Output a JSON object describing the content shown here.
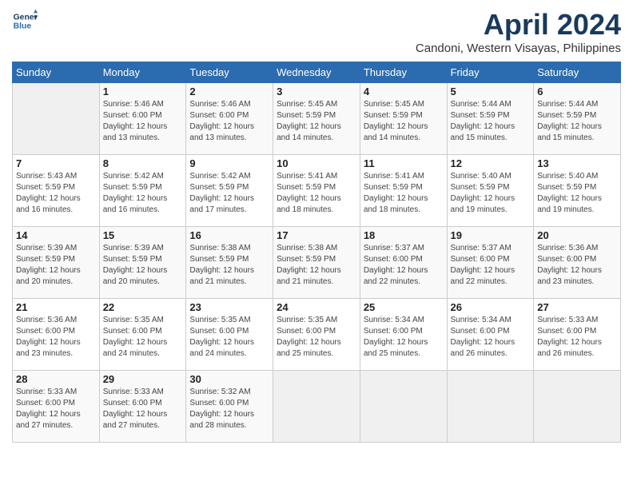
{
  "header": {
    "logo_line1": "General",
    "logo_line2": "Blue",
    "month_title": "April 2024",
    "subtitle": "Candoni, Western Visayas, Philippines"
  },
  "days_of_week": [
    "Sunday",
    "Monday",
    "Tuesday",
    "Wednesday",
    "Thursday",
    "Friday",
    "Saturday"
  ],
  "weeks": [
    [
      {
        "num": "",
        "info": ""
      },
      {
        "num": "1",
        "info": "Sunrise: 5:46 AM\nSunset: 6:00 PM\nDaylight: 12 hours\nand 13 minutes."
      },
      {
        "num": "2",
        "info": "Sunrise: 5:46 AM\nSunset: 6:00 PM\nDaylight: 12 hours\nand 13 minutes."
      },
      {
        "num": "3",
        "info": "Sunrise: 5:45 AM\nSunset: 5:59 PM\nDaylight: 12 hours\nand 14 minutes."
      },
      {
        "num": "4",
        "info": "Sunrise: 5:45 AM\nSunset: 5:59 PM\nDaylight: 12 hours\nand 14 minutes."
      },
      {
        "num": "5",
        "info": "Sunrise: 5:44 AM\nSunset: 5:59 PM\nDaylight: 12 hours\nand 15 minutes."
      },
      {
        "num": "6",
        "info": "Sunrise: 5:44 AM\nSunset: 5:59 PM\nDaylight: 12 hours\nand 15 minutes."
      }
    ],
    [
      {
        "num": "7",
        "info": "Sunrise: 5:43 AM\nSunset: 5:59 PM\nDaylight: 12 hours\nand 16 minutes."
      },
      {
        "num": "8",
        "info": "Sunrise: 5:42 AM\nSunset: 5:59 PM\nDaylight: 12 hours\nand 16 minutes."
      },
      {
        "num": "9",
        "info": "Sunrise: 5:42 AM\nSunset: 5:59 PM\nDaylight: 12 hours\nand 17 minutes."
      },
      {
        "num": "10",
        "info": "Sunrise: 5:41 AM\nSunset: 5:59 PM\nDaylight: 12 hours\nand 18 minutes."
      },
      {
        "num": "11",
        "info": "Sunrise: 5:41 AM\nSunset: 5:59 PM\nDaylight: 12 hours\nand 18 minutes."
      },
      {
        "num": "12",
        "info": "Sunrise: 5:40 AM\nSunset: 5:59 PM\nDaylight: 12 hours\nand 19 minutes."
      },
      {
        "num": "13",
        "info": "Sunrise: 5:40 AM\nSunset: 5:59 PM\nDaylight: 12 hours\nand 19 minutes."
      }
    ],
    [
      {
        "num": "14",
        "info": "Sunrise: 5:39 AM\nSunset: 5:59 PM\nDaylight: 12 hours\nand 20 minutes."
      },
      {
        "num": "15",
        "info": "Sunrise: 5:39 AM\nSunset: 5:59 PM\nDaylight: 12 hours\nand 20 minutes."
      },
      {
        "num": "16",
        "info": "Sunrise: 5:38 AM\nSunset: 5:59 PM\nDaylight: 12 hours\nand 21 minutes."
      },
      {
        "num": "17",
        "info": "Sunrise: 5:38 AM\nSunset: 5:59 PM\nDaylight: 12 hours\nand 21 minutes."
      },
      {
        "num": "18",
        "info": "Sunrise: 5:37 AM\nSunset: 6:00 PM\nDaylight: 12 hours\nand 22 minutes."
      },
      {
        "num": "19",
        "info": "Sunrise: 5:37 AM\nSunset: 6:00 PM\nDaylight: 12 hours\nand 22 minutes."
      },
      {
        "num": "20",
        "info": "Sunrise: 5:36 AM\nSunset: 6:00 PM\nDaylight: 12 hours\nand 23 minutes."
      }
    ],
    [
      {
        "num": "21",
        "info": "Sunrise: 5:36 AM\nSunset: 6:00 PM\nDaylight: 12 hours\nand 23 minutes."
      },
      {
        "num": "22",
        "info": "Sunrise: 5:35 AM\nSunset: 6:00 PM\nDaylight: 12 hours\nand 24 minutes."
      },
      {
        "num": "23",
        "info": "Sunrise: 5:35 AM\nSunset: 6:00 PM\nDaylight: 12 hours\nand 24 minutes."
      },
      {
        "num": "24",
        "info": "Sunrise: 5:35 AM\nSunset: 6:00 PM\nDaylight: 12 hours\nand 25 minutes."
      },
      {
        "num": "25",
        "info": "Sunrise: 5:34 AM\nSunset: 6:00 PM\nDaylight: 12 hours\nand 25 minutes."
      },
      {
        "num": "26",
        "info": "Sunrise: 5:34 AM\nSunset: 6:00 PM\nDaylight: 12 hours\nand 26 minutes."
      },
      {
        "num": "27",
        "info": "Sunrise: 5:33 AM\nSunset: 6:00 PM\nDaylight: 12 hours\nand 26 minutes."
      }
    ],
    [
      {
        "num": "28",
        "info": "Sunrise: 5:33 AM\nSunset: 6:00 PM\nDaylight: 12 hours\nand 27 minutes."
      },
      {
        "num": "29",
        "info": "Sunrise: 5:33 AM\nSunset: 6:00 PM\nDaylight: 12 hours\nand 27 minutes."
      },
      {
        "num": "30",
        "info": "Sunrise: 5:32 AM\nSunset: 6:00 PM\nDaylight: 12 hours\nand 28 minutes."
      },
      {
        "num": "",
        "info": ""
      },
      {
        "num": "",
        "info": ""
      },
      {
        "num": "",
        "info": ""
      },
      {
        "num": "",
        "info": ""
      }
    ]
  ]
}
